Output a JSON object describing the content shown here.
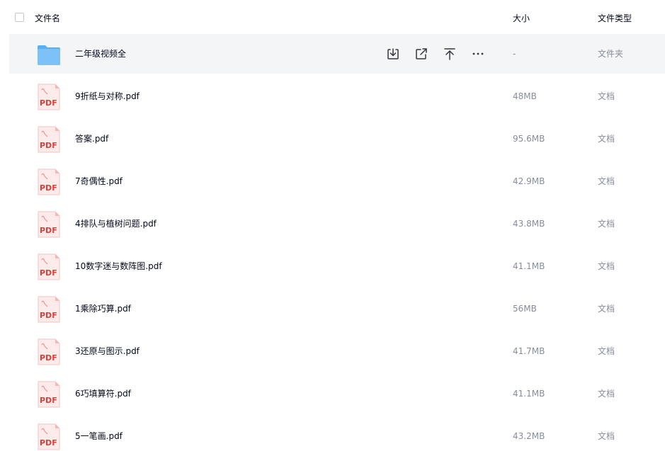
{
  "header": {
    "name_label": "文件名",
    "size_label": "大小",
    "type_label": "文件类型"
  },
  "icons": {
    "folder": "folder-icon",
    "pdf": "pdf-file-icon",
    "pdf_text": "PDF",
    "actions": [
      "download-icon",
      "share-icon",
      "pin-top-icon",
      "more-icon"
    ]
  },
  "colors": {
    "folder": "#6db8f5",
    "pdf_red": "#d9423a",
    "hover_row": "#f4f5f7",
    "muted_text": "#878c9c"
  },
  "rows": [
    {
      "name": "二年级视频全",
      "size": "-",
      "type": "文件夹",
      "kind": "folder"
    },
    {
      "name": "9折纸与对称.pdf",
      "size": "48MB",
      "type": "文档",
      "kind": "pdf"
    },
    {
      "name": "答案.pdf",
      "size": "95.6MB",
      "type": "文档",
      "kind": "pdf"
    },
    {
      "name": "7奇偶性.pdf",
      "size": "42.9MB",
      "type": "文档",
      "kind": "pdf"
    },
    {
      "name": "4排队与植树问题.pdf",
      "size": "43.8MB",
      "type": "文档",
      "kind": "pdf"
    },
    {
      "name": "10数字迷与数阵图.pdf",
      "size": "41.1MB",
      "type": "文档",
      "kind": "pdf"
    },
    {
      "name": "1乘除巧算.pdf",
      "size": "56MB",
      "type": "文档",
      "kind": "pdf"
    },
    {
      "name": "3还原与图示.pdf",
      "size": "41.7MB",
      "type": "文档",
      "kind": "pdf"
    },
    {
      "name": "6巧填算符.pdf",
      "size": "41.1MB",
      "type": "文档",
      "kind": "pdf"
    },
    {
      "name": "5一笔画.pdf",
      "size": "43.2MB",
      "type": "文档",
      "kind": "pdf"
    }
  ]
}
